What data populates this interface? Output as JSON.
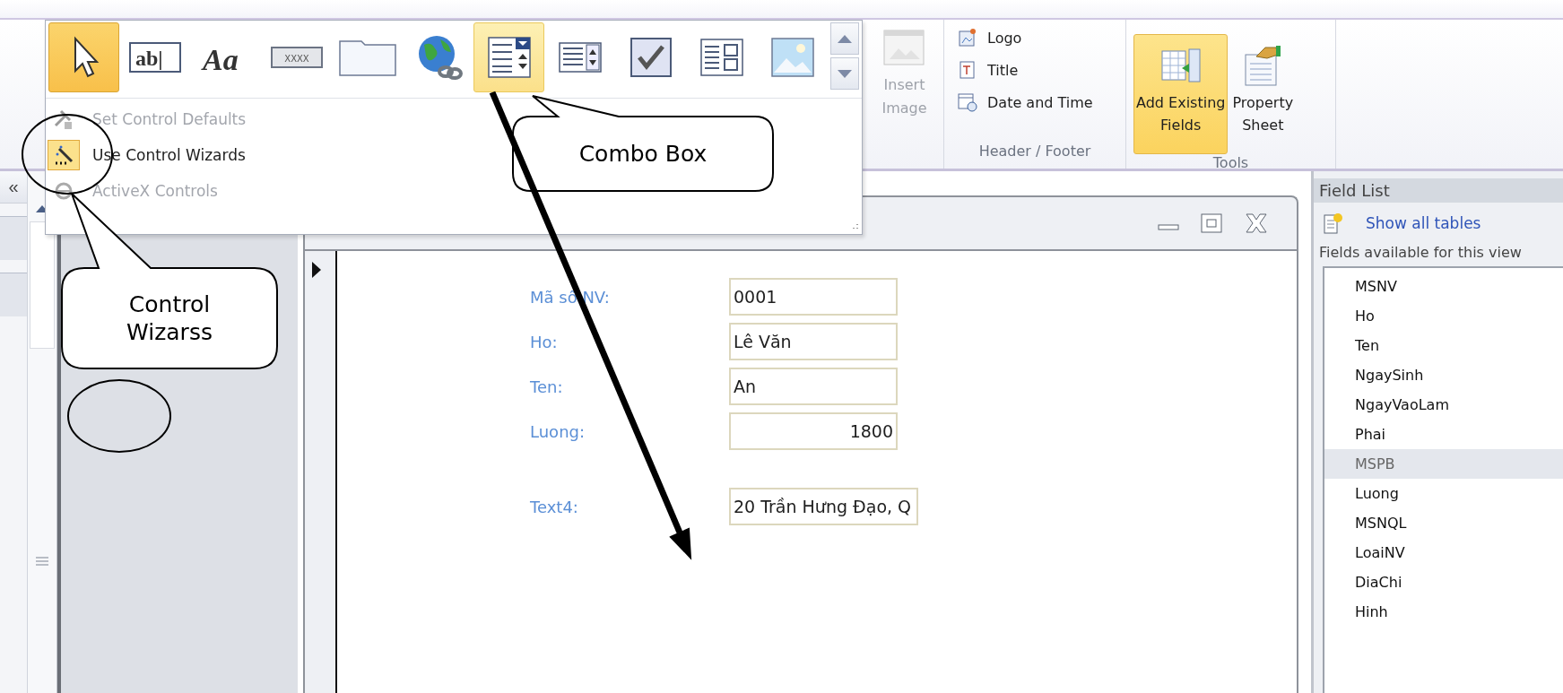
{
  "ribbon": {
    "insert_image": {
      "lines": [
        "Insert",
        "Image"
      ],
      "disabled": true
    },
    "header_footer": {
      "items": [
        {
          "kind": "logo",
          "label": "Logo"
        },
        {
          "kind": "title",
          "label": "Title"
        },
        {
          "kind": "datetime",
          "label": "Date and Time"
        }
      ],
      "group_label": "Header / Footer"
    },
    "tools": {
      "items": [
        {
          "kind": "add_fields",
          "lines": [
            "Add Existing",
            "Fields"
          ],
          "selected": true
        },
        {
          "kind": "property_sheet",
          "lines": [
            "Property",
            "Sheet"
          ],
          "selected": false
        }
      ],
      "group_label": "Tools"
    }
  },
  "controls_gallery": {
    "items": [
      {
        "kind": "pointer",
        "selected": true,
        "hovered": false
      },
      {
        "kind": "textbox",
        "glyph": "ab|",
        "selected": false,
        "hovered": false
      },
      {
        "kind": "label",
        "glyph": "Aa",
        "selected": false,
        "hovered": false
      },
      {
        "kind": "button",
        "glyph": "XXXX",
        "selected": false,
        "hovered": false
      },
      {
        "kind": "tab",
        "selected": false,
        "hovered": false
      },
      {
        "kind": "hyperlink",
        "selected": false,
        "hovered": false
      },
      {
        "kind": "combo",
        "selected": false,
        "hovered": true
      },
      {
        "kind": "listbox",
        "selected": false,
        "hovered": false
      },
      {
        "kind": "checkbox",
        "selected": false,
        "hovered": false
      },
      {
        "kind": "option_group",
        "selected": false,
        "hovered": false
      },
      {
        "kind": "image",
        "selected": false,
        "hovered": false
      }
    ],
    "menu": [
      {
        "kind": "defaults",
        "label": "Set Control Defaults",
        "disabled": true,
        "checked": false
      },
      {
        "kind": "wizards",
        "label": "Use Control Wizards",
        "disabled": false,
        "checked": true
      },
      {
        "kind": "activex",
        "label": "ActiveX Controls",
        "disabled": true,
        "checked": false
      }
    ]
  },
  "nav_pane": {
    "collapse_button": "«"
  },
  "form_window": {
    "fields": [
      {
        "label": "Mã số NV:",
        "value": "0001",
        "right_aligned": false,
        "separated": false
      },
      {
        "label": "Ho:",
        "value": "Lê Văn",
        "right_aligned": false,
        "separated": false
      },
      {
        "label": "Ten:",
        "value": "An",
        "right_aligned": false,
        "separated": false
      },
      {
        "label": "Luong:",
        "value": "1800",
        "right_aligned": true,
        "separated": false
      },
      {
        "label": "Text4:",
        "value": "20 Trần Hưng Đạo, Q",
        "right_aligned": false,
        "separated": true
      }
    ]
  },
  "field_list": {
    "title": "Field List",
    "link": "Show all tables",
    "caption": "Fields available for this view",
    "items": [
      {
        "label": "MSNV",
        "selected": false
      },
      {
        "label": "Ho",
        "selected": false
      },
      {
        "label": "Ten",
        "selected": false
      },
      {
        "label": "NgaySinh",
        "selected": false
      },
      {
        "label": "NgayVaoLam",
        "selected": false
      },
      {
        "label": "Phai",
        "selected": false
      },
      {
        "label": "MSPB",
        "selected": true
      },
      {
        "label": "Luong",
        "selected": false
      },
      {
        "label": "MSNQL",
        "selected": false
      },
      {
        "label": "LoaiNV",
        "selected": false
      },
      {
        "label": "DiaChi",
        "selected": false
      },
      {
        "label": "Hinh",
        "selected": false
      }
    ]
  },
  "callouts": [
    {
      "kind": "combo",
      "text": "Combo Box"
    },
    {
      "kind": "wizards",
      "text": "Control Wizarss"
    }
  ]
}
